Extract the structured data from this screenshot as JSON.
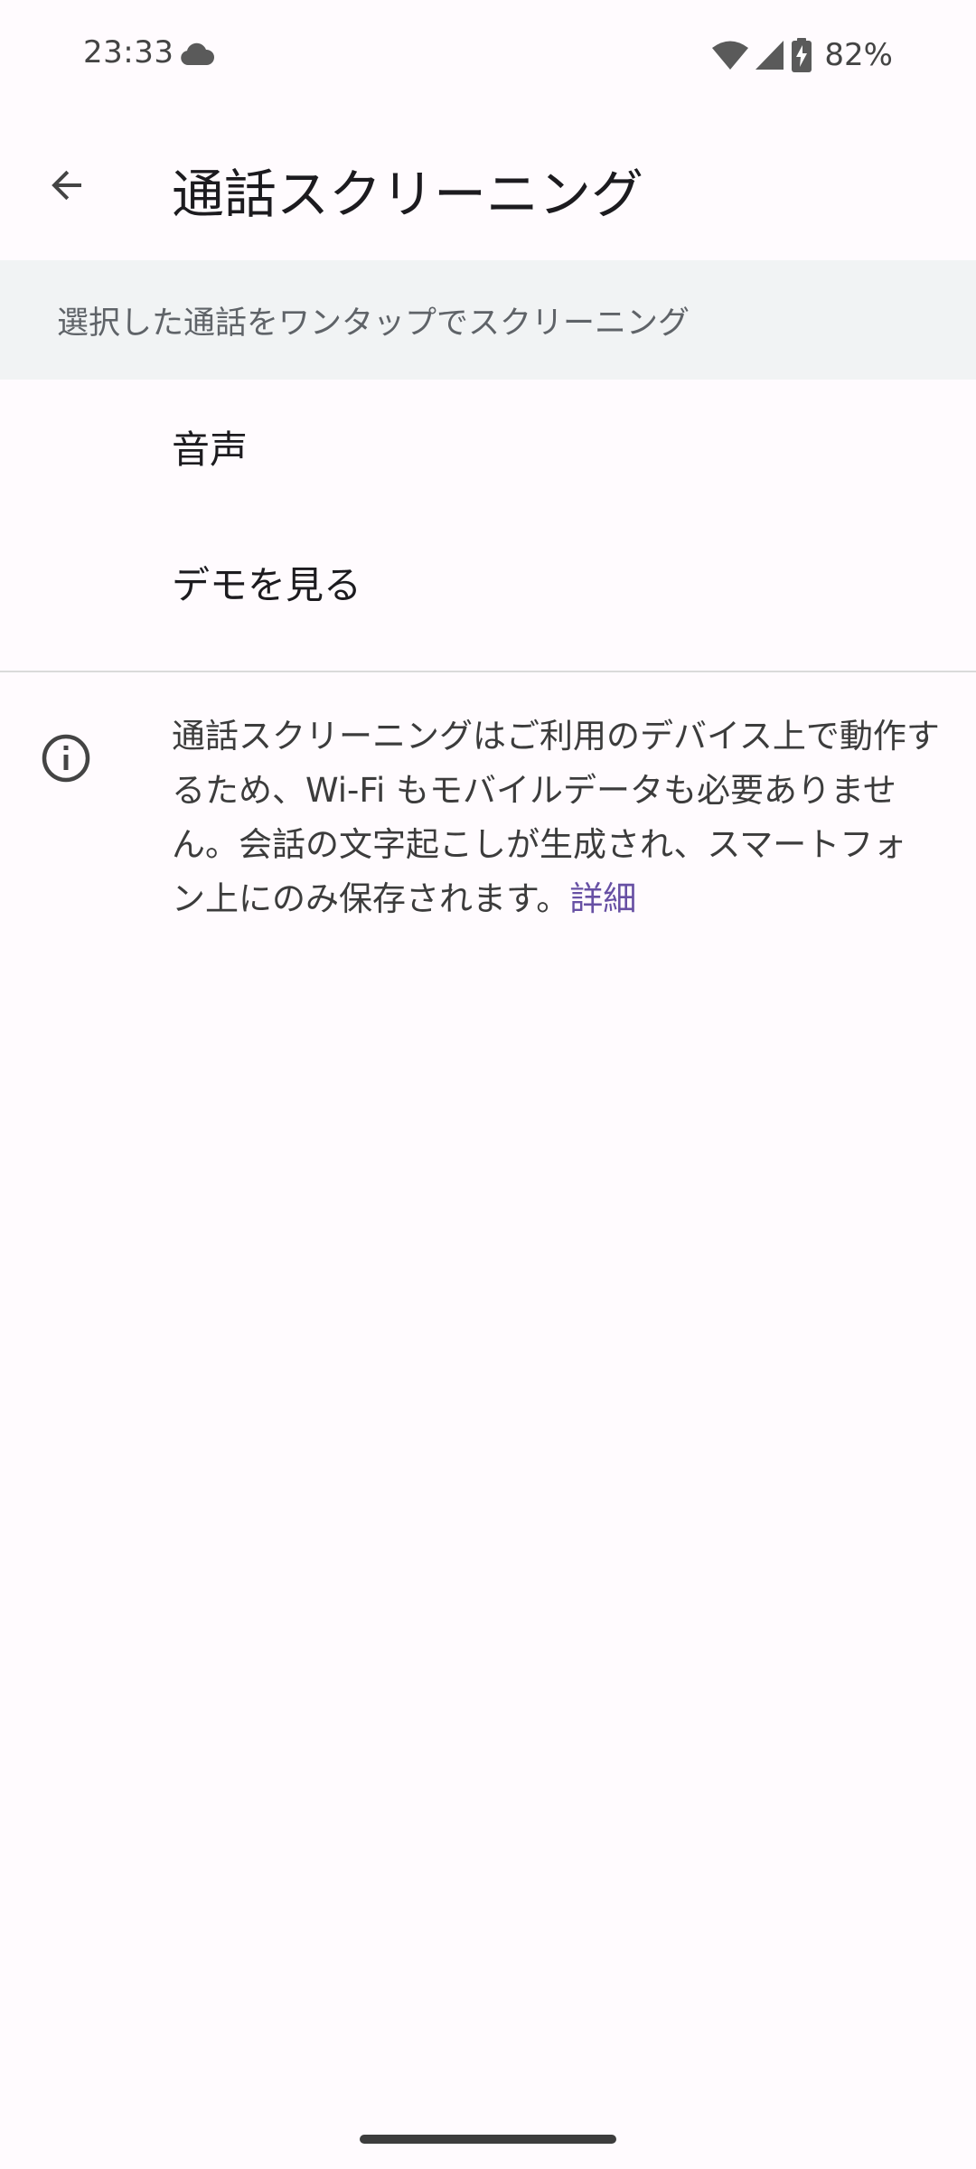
{
  "status_bar": {
    "time": "23:33",
    "battery": "82%",
    "icons": [
      "cloud-icon",
      "wifi-icon",
      "cell-signal-icon",
      "battery-charging-icon"
    ]
  },
  "app_bar": {
    "back_icon": "arrow-back-icon",
    "title": "通話スクリーニング"
  },
  "section": {
    "header": "選択した通話をワンタップでスクリーニング",
    "items": [
      {
        "label": "音声"
      },
      {
        "label": "デモを見る"
      }
    ]
  },
  "info": {
    "icon": "info-icon",
    "text": "通話スクリーニングはご利用のデバイス上で動作するため、Wi-Fi もモバイルデータも必要ありません。会話の文字起こしが生成され、スマートフォン上にのみ保存されます。",
    "link": "詳細"
  },
  "colors": {
    "background": "#fffbfe",
    "section_header_bg": "#f1f3f4",
    "link": "#6750a4"
  }
}
